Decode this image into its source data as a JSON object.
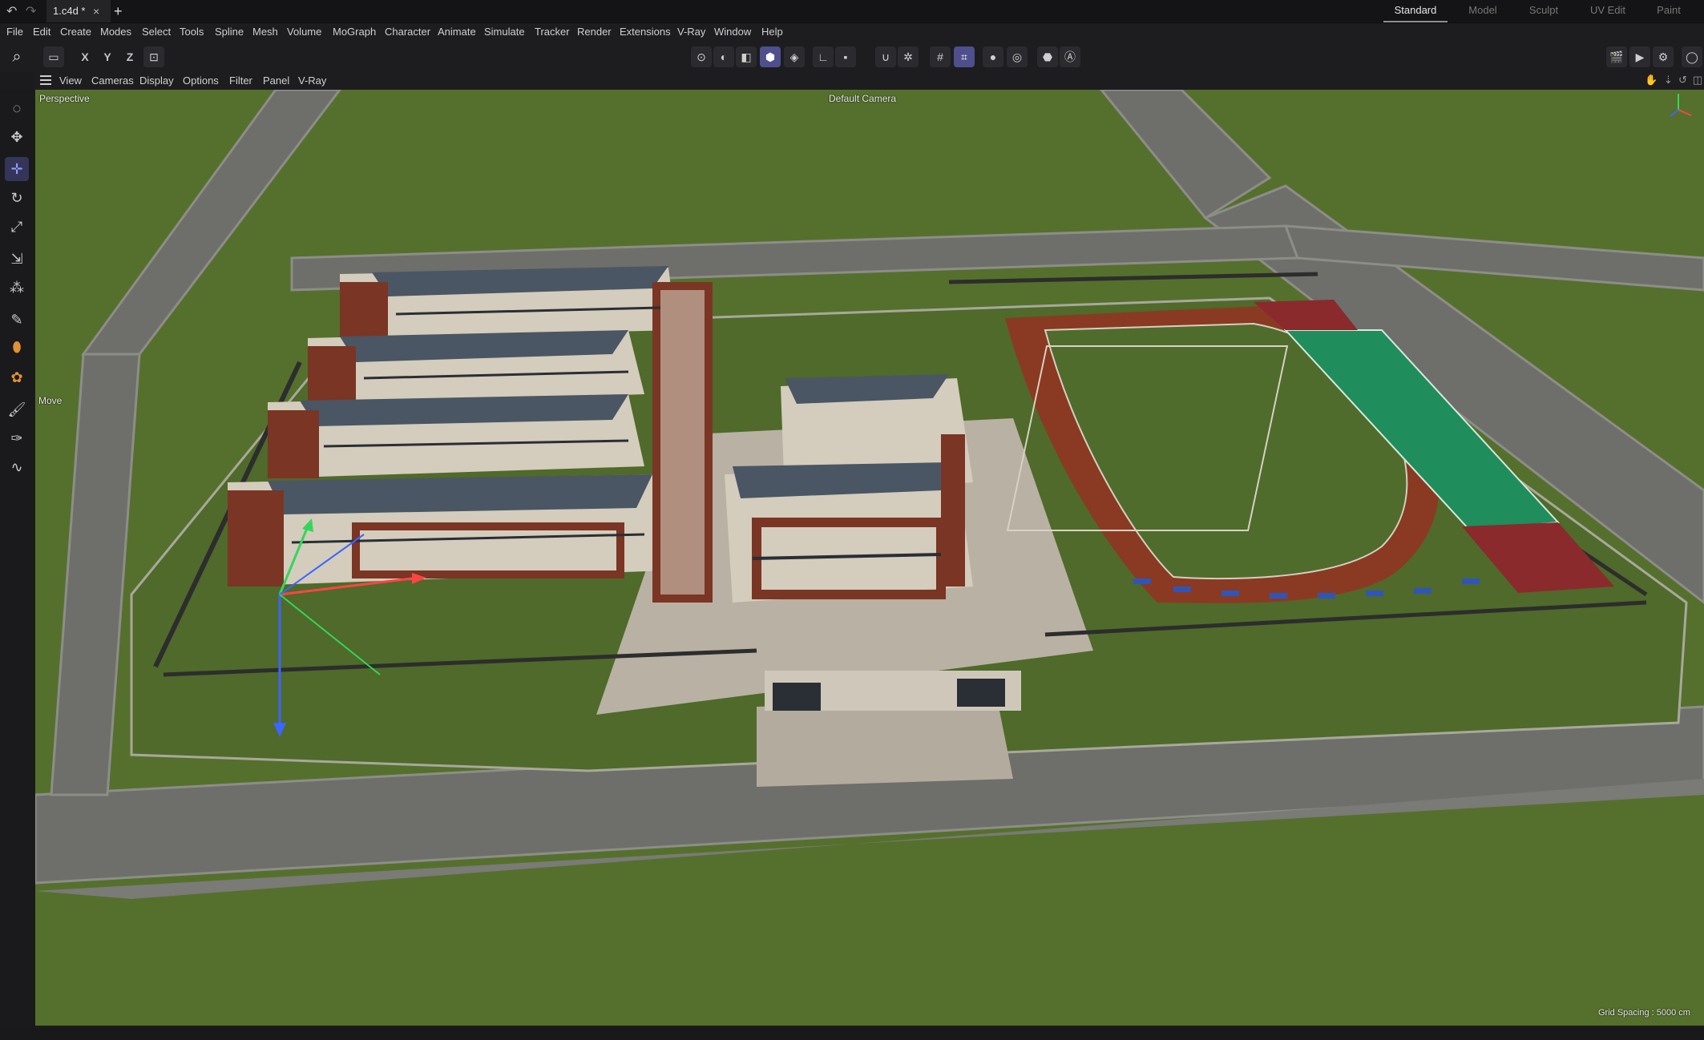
{
  "titlebar": {
    "undo_icon": "undo-icon",
    "redo_icon": "redo-icon",
    "doc_tab": "1.c4d *",
    "close": "×",
    "new_tab": "+",
    "layouts": [
      {
        "label": "Standard",
        "active": true
      },
      {
        "label": "Model",
        "active": false
      },
      {
        "label": "Sculpt",
        "active": false
      },
      {
        "label": "UV Edit",
        "active": false
      },
      {
        "label": "Paint",
        "active": false
      }
    ]
  },
  "menubar": [
    "File",
    "Edit",
    "Create",
    "Modes",
    "Select",
    "Tools",
    "Spline",
    "Mesh",
    "Volume",
    "MoGraph",
    "Character",
    "Animate",
    "Simulate",
    "Tracker",
    "Render",
    "Extensions",
    "V-Ray",
    "Window",
    "Help"
  ],
  "toolbar": {
    "axis_x": "X",
    "axis_y": "Y",
    "axis_z": "Z"
  },
  "viewport_menu": [
    "View",
    "Cameras",
    "Display",
    "Options",
    "Filter",
    "Panel",
    "V-Ray"
  ],
  "viewport": {
    "view_name": "Perspective",
    "camera": "Default Camera",
    "tool_label": "Move",
    "grid_spacing": "Grid Spacing : 5000 cm"
  },
  "colors": {
    "grass": "#56722e",
    "road": "#6f6f6b",
    "track": "#8a3a22",
    "court_green": "#1f8d5c",
    "court_red": "#8a2a2c",
    "brick": "#7a3524",
    "roof": "#4a5663",
    "accent": "#4e4f8c"
  }
}
